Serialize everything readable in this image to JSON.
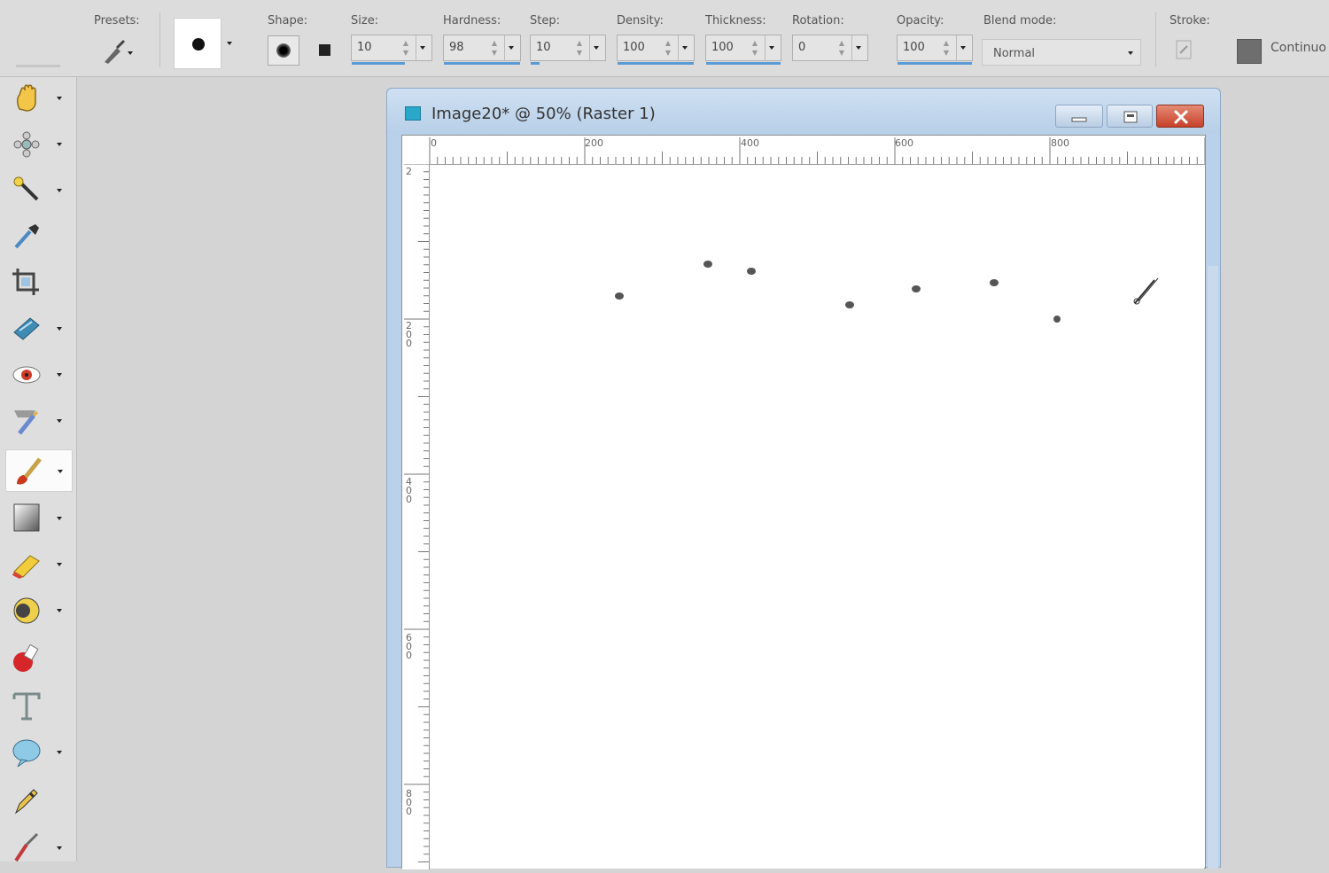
{
  "toolbar": {
    "presets_label": "Presets:",
    "shape_label": "Shape:",
    "size_label": "Size:",
    "size_value": "10",
    "hardness_label": "Hardness:",
    "hardness_value": "98",
    "step_label": "Step:",
    "step_value": "10",
    "density_label": "Density:",
    "density_value": "100",
    "thickness_label": "Thickness:",
    "thickness_value": "100",
    "rotation_label": "Rotation:",
    "rotation_value": "0",
    "opacity_label": "Opacity:",
    "opacity_value": "100",
    "blend_label": "Blend mode:",
    "blend_value": "Normal",
    "stroke_label": "Stroke:",
    "continuous_label": "Continuo"
  },
  "tools": [
    {
      "icon": "pan-hand-icon"
    },
    {
      "icon": "move-pick-icon"
    },
    {
      "icon": "magic-wand-icon"
    },
    {
      "icon": "dropper-icon"
    },
    {
      "icon": "crop-icon"
    },
    {
      "icon": "straighten-icon"
    },
    {
      "icon": "red-eye-icon"
    },
    {
      "icon": "makeover-icon"
    },
    {
      "icon": "paint-brush-icon",
      "active": true
    },
    {
      "icon": "gradient-icon"
    },
    {
      "icon": "eraser-icon"
    },
    {
      "icon": "smudge-icon"
    },
    {
      "icon": "flood-fill-icon"
    },
    {
      "icon": "text-icon"
    },
    {
      "icon": "preset-shape-icon"
    },
    {
      "icon": "pen-icon"
    },
    {
      "icon": "warp-brush-icon"
    }
  ],
  "document": {
    "title": "Image20* @  50% (Raster 1)",
    "ruler_h_labels": [
      "0",
      "200",
      "400",
      "600",
      "800"
    ],
    "ruler_v_labels": [
      "2",
      "2\n0\n0",
      "4\n0\n0",
      "6\n0\n0",
      "8\n0\n0"
    ],
    "accent": "#b9d1ea"
  }
}
